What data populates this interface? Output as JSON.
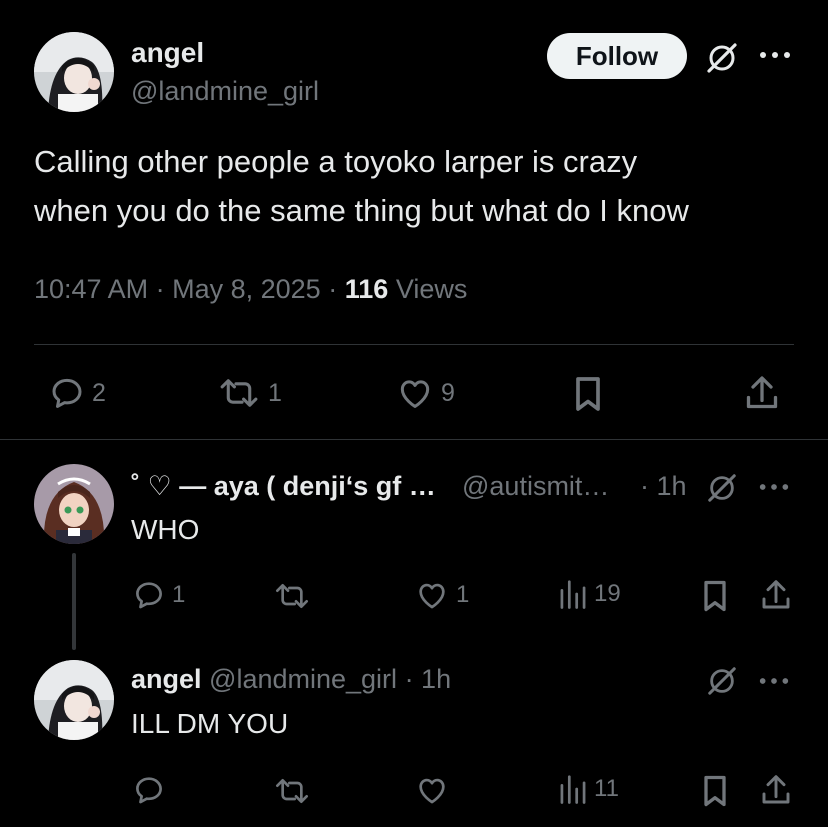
{
  "main_tweet": {
    "display_name": "angel",
    "handle": "@landmine_girl",
    "follow_label": "Follow",
    "text_line1": "Calling other people a toyoko larper is crazy",
    "text_line2": "when you do the same thing but what do I know",
    "time": "10:47 AM",
    "sep1": "·",
    "date": "May 8, 2025",
    "sep2": "·",
    "views_count": "116",
    "views_label": "Views",
    "replies": "2",
    "retweets": "1",
    "likes": "9"
  },
  "reply1": {
    "display_name": "˚ ♡ — aya ( denji‘s gf …",
    "handle": "@autismit…",
    "time": "· 1h",
    "text": "WHO",
    "replies": "1",
    "likes": "1",
    "views": "19"
  },
  "reply2": {
    "display_name": "angel",
    "handle": "@landmine_girl",
    "time": "· 1h",
    "text": "ILL DM YOU",
    "views": "11"
  },
  "colors": {
    "background": "#000000",
    "text": "#e7e9ea",
    "muted": "#71767b",
    "divider": "#2f3336",
    "follow_bg": "#eff3f4"
  },
  "icons": [
    "grok-icon",
    "more-icon",
    "reply-icon",
    "retweet-icon",
    "like-icon",
    "bookmark-icon",
    "share-icon",
    "views-icon"
  ]
}
